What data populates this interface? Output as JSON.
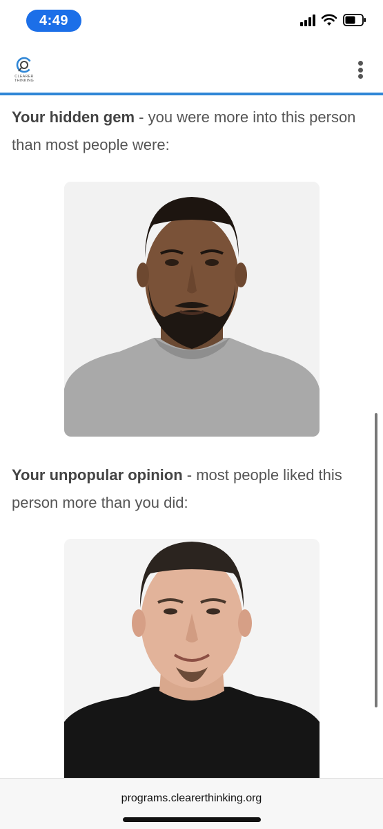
{
  "status_bar": {
    "time": "4:49"
  },
  "header": {
    "logo_line1": "CLEARER",
    "logo_line2": "THINKING",
    "accent_color": "#2f86d6"
  },
  "sections": [
    {
      "heading": "Your hidden gem",
      "text": " - you were more into this person than most people were:",
      "photo": "portrait-man-gray-sweater"
    },
    {
      "heading": "Your unpopular opinion",
      "text": " - most people liked this person more than you did:",
      "photo": "portrait-man-black-shirt"
    }
  ],
  "browser": {
    "url": "programs.clearerthinking.org"
  }
}
